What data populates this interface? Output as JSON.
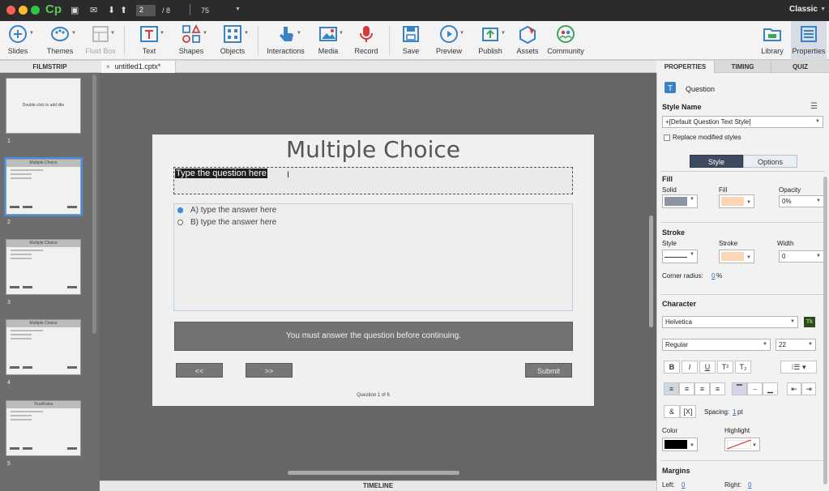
{
  "titlebar": {
    "app_logo": "Cp",
    "slide_current": "2",
    "slide_total": "/ 8",
    "zoom": "75",
    "workspace": "Classic"
  },
  "toolbar": {
    "slides": "Slides",
    "themes": "Themes",
    "fluid_box": "Fluid Box",
    "text": "Text",
    "shapes": "Shapes",
    "objects": "Objects",
    "interactions": "Interactions",
    "media": "Media",
    "record": "Record",
    "save": "Save",
    "preview": "Preview",
    "publish": "Publish",
    "assets": "Assets",
    "community": "Community",
    "library": "Library",
    "properties": "Properties"
  },
  "filmstrip": {
    "header": "FILMSTRIP",
    "slides": [
      {
        "num": "1",
        "title": "Double click to add title"
      },
      {
        "num": "2",
        "title": "Multiple Choice"
      },
      {
        "num": "3",
        "title": "Multiple Choice"
      },
      {
        "num": "4",
        "title": "Multiple Choice"
      },
      {
        "num": "5",
        "title": "True/False"
      }
    ]
  },
  "document": {
    "tab_close": "×",
    "tab_name": "untitled1.cptx*"
  },
  "slide": {
    "title": "Multiple Choice",
    "question": "Type the question here",
    "answers": [
      "A) type the answer here",
      "B) type the answer here"
    ],
    "message": "You must answer the question before continuing.",
    "back_button": "<<",
    "next_button": ">>",
    "submit_button": "Submit",
    "counter": "Question 1 of 6"
  },
  "timeline": {
    "label": "TIMELINE"
  },
  "properties": {
    "tabs": [
      "PROPERTIES",
      "TIMING",
      "QUIZ"
    ],
    "object_name": "Question",
    "style_name_label": "Style Name",
    "style_name_value": "+[Default Question Text Style]",
    "replace_modified": "Replace modified styles",
    "seg_style": "Style",
    "seg_options": "Options",
    "fill": {
      "header": "Fill",
      "solid_label": "Solid",
      "fill_label": "Fill",
      "opacity_label": "Opacity",
      "opacity_value": "0%"
    },
    "stroke": {
      "header": "Stroke",
      "style_label": "Style",
      "stroke_label": "Stroke",
      "width_label": "Width",
      "width_value": "0",
      "corner_label": "Corner radius:",
      "corner_value": "0",
      "corner_unit": "%"
    },
    "character": {
      "header": "Character",
      "font": "Helvetica",
      "weight": "Regular",
      "size": "22",
      "bold": "B",
      "italic": "I",
      "underline": "U",
      "superscript": "T²",
      "subscript": "T₂",
      "spacing_label": "Spacing:",
      "spacing_value": "1",
      "spacing_unit": "pt",
      "color_label": "Color",
      "highlight_label": "Highlight",
      "amp": "&",
      "var": "[X]",
      "typekit": "Tk"
    },
    "margins": {
      "header": "Margins",
      "left_label": "Left:",
      "left_value": "0",
      "right_label": "Right:",
      "right_value": "0"
    }
  },
  "colors": {
    "accent": "#3f8ee8",
    "selected_segment": "#3d4a62",
    "fill_solid": "#8d95a3",
    "fill_color": "#fbd6b5",
    "stroke_color": "#fbd6b5",
    "char_color": "#000000",
    "cp_green": "#59c85a"
  }
}
